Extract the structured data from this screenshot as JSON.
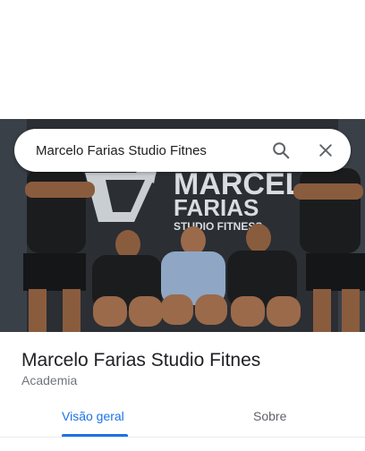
{
  "search": {
    "query": "Marcelo Farias Studio Fitnes"
  },
  "hero": {
    "sign_line1": "MARCELO",
    "sign_line2": "FARIAS",
    "sign_line3": "STUDIO  FITNESS"
  },
  "place": {
    "name": "Marcelo Farias Studio Fitnes",
    "category": "Academia"
  },
  "tabs": [
    {
      "label": "Visão geral",
      "active": true
    },
    {
      "label": "Sobre",
      "active": false
    }
  ],
  "colors": {
    "accent": "#1a73e8",
    "sign_text": "#d9dde1",
    "shirt_black": "#1b1c1e",
    "shirt_blue": "#8fa7c4",
    "skin": "#9a6a4a"
  },
  "icons": {
    "search_button": "search-icon",
    "close_button": "close-icon"
  }
}
